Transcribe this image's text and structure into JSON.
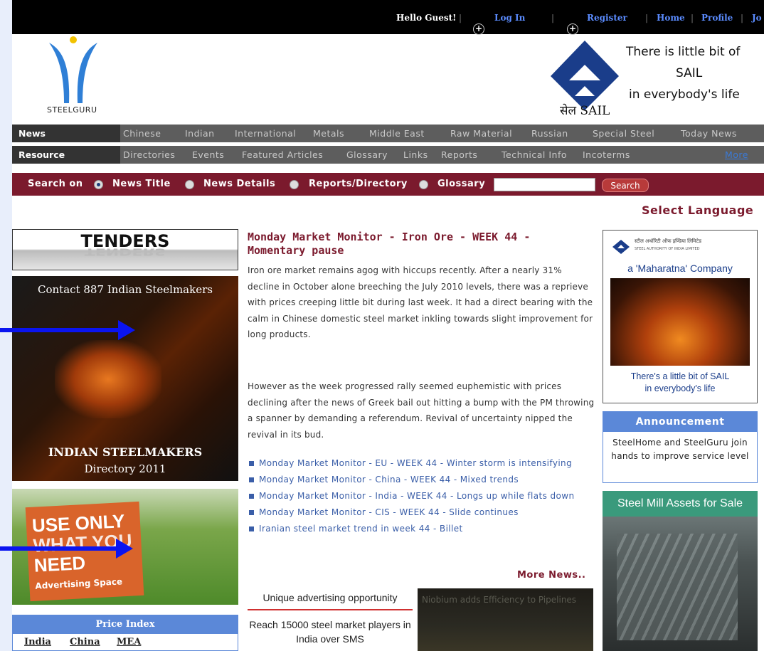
{
  "topbar": {
    "greeting": "Hello Guest!",
    "login": "Log In",
    "register": "Register",
    "home": "Home",
    "profile": "Profile",
    "jo": "Jo"
  },
  "logo": {
    "text": "STEELGURU"
  },
  "sail_banner": {
    "line1": "There is little bit of",
    "line2": "SAIL",
    "line3": "in everybody's life",
    "brand": "सेल SAIL"
  },
  "nav_news": {
    "head": "News",
    "items": [
      "Chinese",
      "Indian",
      "International",
      "Metals",
      "Middle East",
      "Raw Material",
      "Russian",
      "Special Steel",
      "Today News"
    ]
  },
  "nav_resource": {
    "head": "Resource",
    "items": [
      "Directories",
      "Events",
      "Featured Articles",
      "Glossary",
      "Links",
      "Reports",
      "Technical Info",
      "Incoterms"
    ],
    "more": "More"
  },
  "search": {
    "label": "Search on",
    "options": [
      "News Title",
      "News Details",
      "Reports/Directory",
      "Glossary"
    ],
    "selected": "News Title",
    "button": "Search",
    "value": ""
  },
  "select_language": "Select Language",
  "left": {
    "tenders": "TENDERS",
    "steelmakers_contact": "Contact 887 Indian Steelmakers",
    "steelmakers_title": "INDIAN STEELMAKERS",
    "steelmakers_sub": "Directory 2011",
    "adspace_line1": "USE ONLY",
    "adspace_line2": "WHAT YOU",
    "adspace_line3": "NEED",
    "adspace_label": "Advertising Space",
    "price_index": "Price Index",
    "price_tabs": [
      "India",
      "China",
      "MEA"
    ]
  },
  "article": {
    "title": "Monday Market Monitor - Iron Ore - WEEK 44 - Momentary pause",
    "p1": "Iron ore market remains agog with hiccups recently. After a nearly 31% decline in October alone breeching the July 2010 levels, there was a reprieve with prices creeping little bit during last week. It had a direct bearing with the calm in Chinese domestic steel market inkling towards slight improvement for long products.",
    "p2": "However as the week progressed rally seemed euphemistic with prices declining after the news of Greek bail out hitting a bump with the PM throwing a spanner by demanding a referendum. Revival of uncertainty nipped the revival in its bud."
  },
  "news_list": [
    "Monday Market Monitor - EU - WEEK 44 - Winter storm is intensifying",
    "Monday Market Monitor - China - WEEK 44 - Mixed trends",
    "Monday Market Monitor - India - WEEK 44 - Longs up while flats down",
    "Monday Market Monitor - CIS - WEEK 44 - Slide continues",
    "Iranian steel market trend in week 44 - Billet"
  ],
  "more_news": "More News..",
  "unique_ad": {
    "title": "Unique advertising opportunity",
    "body": "Reach 15000 steel market players in India over SMS"
  },
  "pipeline_ad": "Niobium adds Efficiency to Pipelines",
  "right": {
    "sail_hindi": "स्टील अथॉरिटी ऑफ इण्डिया लिमिटेड",
    "sail_english": "STEEL AUTHORITY OF INDIA LIMITED",
    "maharatna": "a 'Maharatna' Company",
    "sail_tag1": "There's a little bit of SAIL",
    "sail_tag2": "in everybody's life",
    "announce_head": "Announcement",
    "announce_body": "SteelHome and SteelGuru join hands to improve service level",
    "mill_head": "Steel Mill Assets for Sale"
  },
  "colors": {
    "maroon": "#7b1a2d",
    "link_blue": "#3a5ea8",
    "arrow_blue": "#0a14f0",
    "header_blue": "#5b88d8"
  }
}
